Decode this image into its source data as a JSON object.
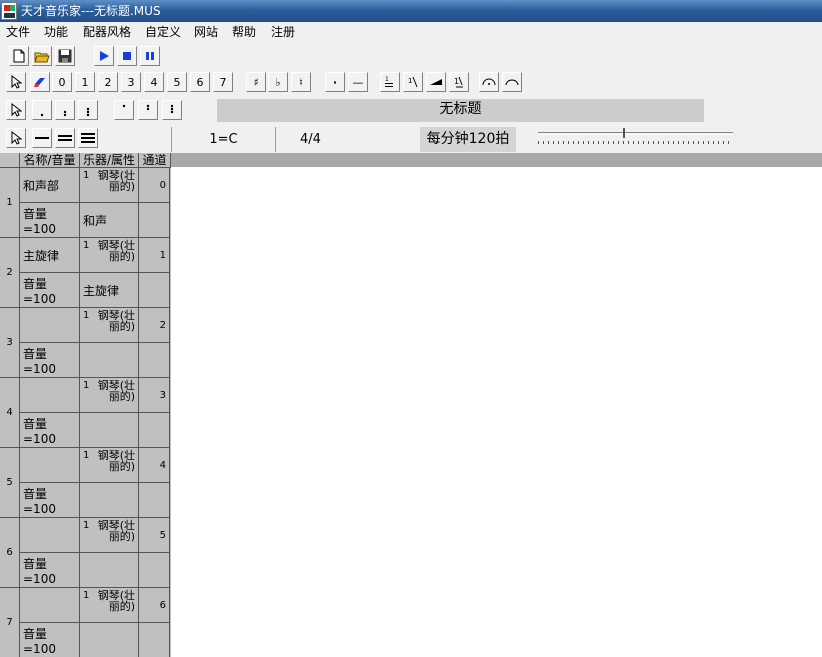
{
  "window": {
    "title": "天才音乐家---无标题.MUS",
    "icon": "app-logo-icon"
  },
  "menu": [
    "文件",
    "功能",
    "配器风格",
    "自定义",
    "网站",
    "帮助",
    "注册"
  ],
  "toolbar1": {
    "buttons": [
      "new-file-icon",
      "open-folder-icon",
      "save-icon",
      "play-icon",
      "stop-icon",
      "pause-icon"
    ]
  },
  "toolbar2": {
    "notes": [
      "0",
      "1",
      "2",
      "3",
      "4",
      "5",
      "6",
      "7"
    ],
    "accidentals": [
      "♯",
      "♭",
      "♮"
    ],
    "dot": "·",
    "dash": "—"
  },
  "document": {
    "title": "无标题"
  },
  "status": {
    "key": "1=C",
    "time_signature": "4/4",
    "tempo": "每分钟120拍",
    "tempo_fraction": 0.44
  },
  "tracks_header": {
    "name_volume": "名称/音量",
    "instrument_attr": "乐器/属性",
    "channel": "通道"
  },
  "tracks": [
    {
      "num": "1",
      "name": "和声部",
      "volume": "音量=100",
      "inst_num": "1",
      "instrument": "钢琴(壮丽的)",
      "attr": "和声",
      "channel": "0"
    },
    {
      "num": "2",
      "name": "主旋律",
      "volume": "音量=100",
      "inst_num": "1",
      "instrument": "钢琴(壮丽的)",
      "attr": "主旋律",
      "channel": "1"
    },
    {
      "num": "3",
      "name": "",
      "volume": "音量=100",
      "inst_num": "1",
      "instrument": "钢琴(壮丽的)",
      "attr": "",
      "channel": "2"
    },
    {
      "num": "4",
      "name": "",
      "volume": "音量=100",
      "inst_num": "1",
      "instrument": "钢琴(壮丽的)",
      "attr": "",
      "channel": "3"
    },
    {
      "num": "5",
      "name": "",
      "volume": "音量=100",
      "inst_num": "1",
      "instrument": "钢琴(壮丽的)",
      "attr": "",
      "channel": "4"
    },
    {
      "num": "6",
      "name": "",
      "volume": "音量=100",
      "inst_num": "1",
      "instrument": "钢琴(壮丽的)",
      "attr": "",
      "channel": "5"
    },
    {
      "num": "7",
      "name": "",
      "volume": "音量=100",
      "inst_num": "1",
      "instrument": "钢琴(壮丽的)",
      "attr": "",
      "channel": "6"
    }
  ]
}
